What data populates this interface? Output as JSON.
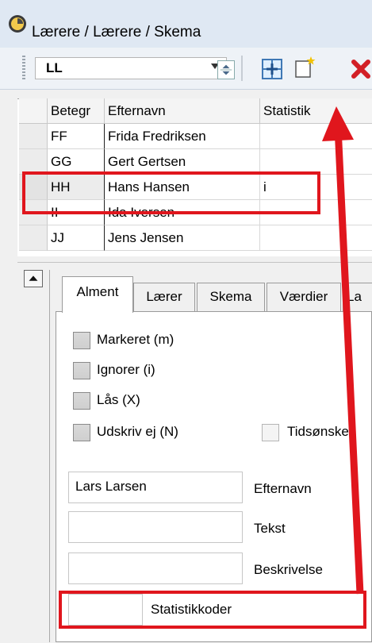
{
  "window": {
    "title": "Lærere / Lærere / Skema"
  },
  "toolbar": {
    "combo_value": "LL"
  },
  "grid": {
    "columns": [
      "Betegr",
      "Efternavn",
      "Statistik"
    ],
    "rows": [
      {
        "code": "FF",
        "name": "Frida Fredriksen",
        "stat": ""
      },
      {
        "code": "GG",
        "name": "Gert Gertsen",
        "stat": ""
      },
      {
        "code": "HH",
        "name": "Hans Hansen",
        "stat": "i"
      },
      {
        "code": "II",
        "name": "Ida Iversen",
        "stat": ""
      },
      {
        "code": "JJ",
        "name": "Jens Jensen",
        "stat": ""
      }
    ]
  },
  "tabs": [
    "Alment",
    "Lærer",
    "Skema",
    "Værdier",
    "La"
  ],
  "checkboxes": [
    "Markeret (m)",
    "Ignorer (i)",
    "Lås (X)",
    "Udskriv ej (N)",
    "Tidsønsker"
  ],
  "fields": [
    {
      "value": "Lars Larsen",
      "label": "Efternavn"
    },
    {
      "value": "",
      "label": "Tekst"
    },
    {
      "value": "",
      "label": "Beskrivelse"
    },
    {
      "value": "",
      "label": "Statistikkoder"
    }
  ],
  "colors": {
    "highlight": "#e0161d"
  }
}
